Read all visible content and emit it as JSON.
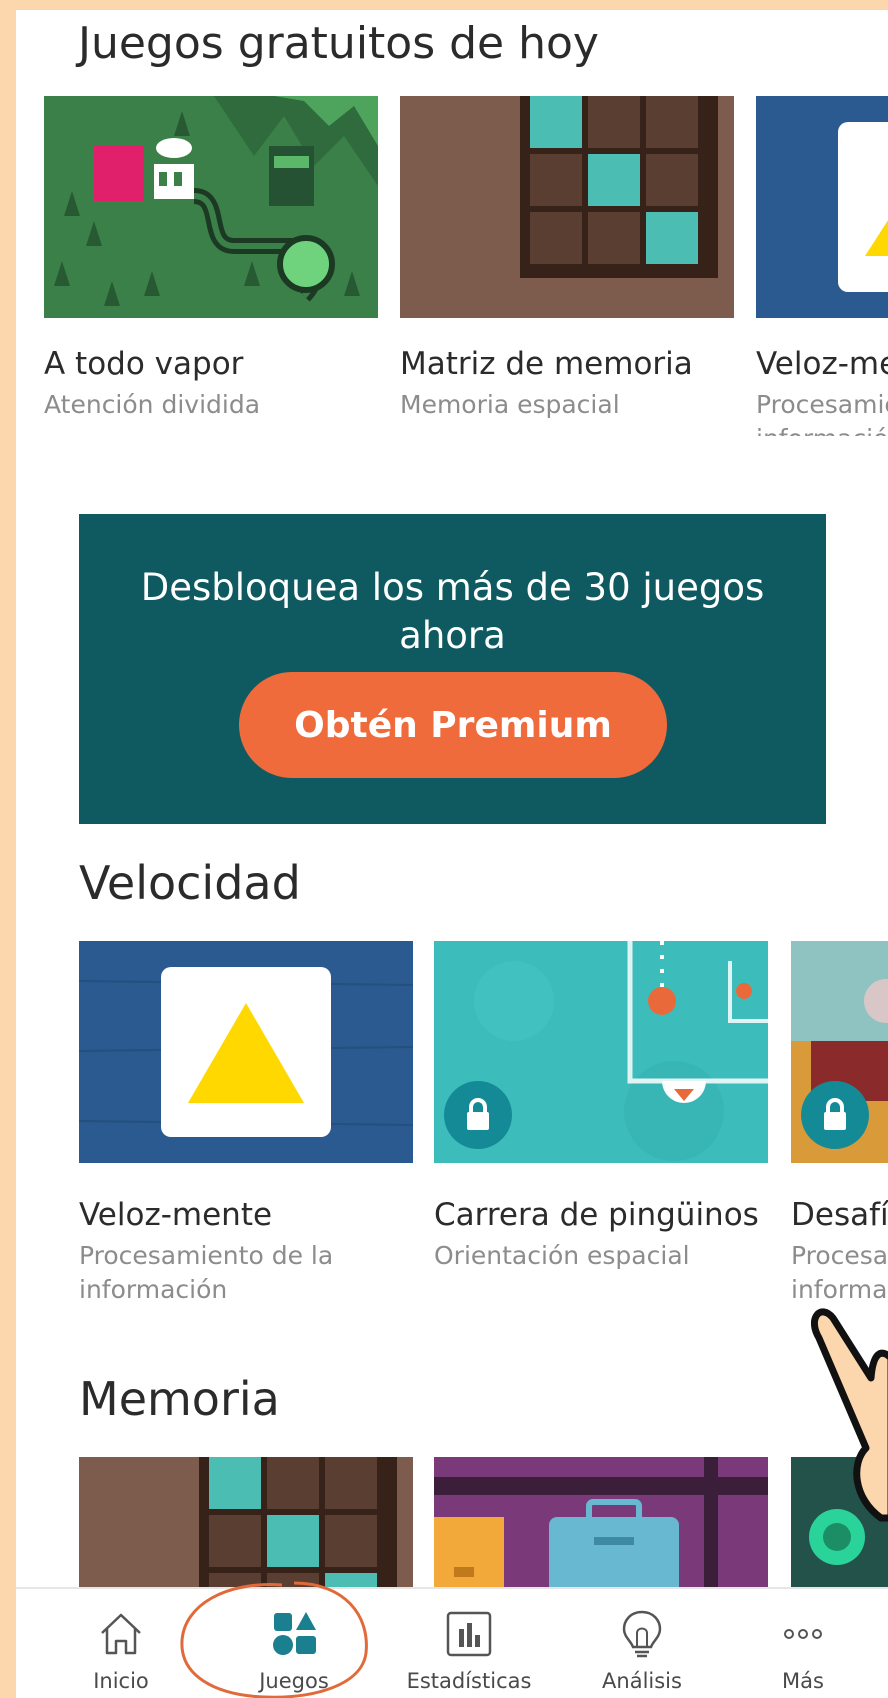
{
  "sections": {
    "free_today": {
      "title": "Juegos gratuitos de hoy",
      "games": [
        {
          "name": "A todo vapor",
          "category": "Atención dividida"
        },
        {
          "name": "Matriz de memoria",
          "category": "Memoria espacial"
        },
        {
          "name": "Veloz-me",
          "category": "Procesamiento de la información"
        }
      ]
    },
    "velocidad": {
      "title": "Velocidad",
      "games": [
        {
          "name": "Veloz-mente",
          "category": "Procesamiento de la información",
          "locked": false
        },
        {
          "name": "Carrera de pingüinos",
          "category": "Orientación espacial",
          "locked": true
        },
        {
          "name": "Desafío",
          "category": "Procesamiento de la información",
          "locked": true
        }
      ]
    },
    "memoria": {
      "title": "Memoria"
    }
  },
  "banner": {
    "line1": "Desbloquea los más de 30 juegos",
    "line2": "ahora",
    "button_label": "Obtén Premium"
  },
  "tabbar": {
    "items": [
      {
        "label": "Inicio",
        "icon": "home-icon"
      },
      {
        "label": "Juegos",
        "icon": "games-icon",
        "active": true
      },
      {
        "label": "Estadísticas",
        "icon": "stats-icon"
      },
      {
        "label": "Análisis",
        "icon": "lightbulb-icon"
      },
      {
        "label": "Más",
        "icon": "more-icon"
      }
    ]
  },
  "colors": {
    "page_background": "#fcd7ae",
    "banner": "#0f5a61",
    "premium_button": "#ef6b3c",
    "lock_badge": "#158a97",
    "annotation": "#e06a3a"
  }
}
